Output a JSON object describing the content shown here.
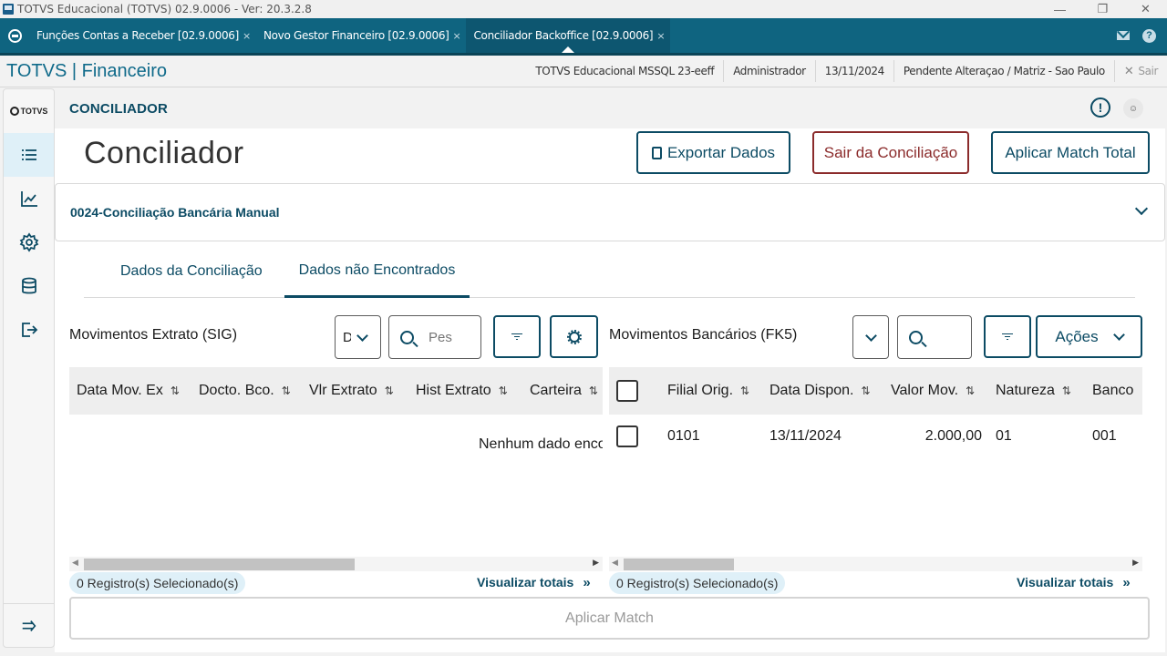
{
  "window": {
    "title": "TOTVS Educacional (TOTVS) 02.9.0006 - Ver: 20.3.2.8"
  },
  "tabs": [
    {
      "label": "Funções Contas a Receber [02.9.0006]",
      "close": "×"
    },
    {
      "label": "Novo Gestor Financeiro [02.9.0006]",
      "close": "×"
    },
    {
      "label": "Conciliador Backoffice [02.9.0006]",
      "close": "×"
    }
  ],
  "header": {
    "brand": "TOTVS | Financeiro",
    "environment": "TOTVS Educacional MSSQL 23-eeff",
    "user": "Administrador",
    "date": "13/11/2024",
    "branch": "Pendente Alteraçao / Matriz - Sao Paulo",
    "exit": "Sair"
  },
  "sidebar": {
    "logo": "TOTVS"
  },
  "breadcrumb": "CONCILIADOR",
  "page": {
    "title": "Conciliador",
    "export_label": "Exportar Dados",
    "exit_conciliation_label": "Sair da Conciliação",
    "apply_total_label": "Aplicar Match Total",
    "config_name": "0024-Conciliação Bancária Manual",
    "tabs": [
      "Dados da Conciliação",
      "Dados não Encontrados"
    ],
    "apply_match_label": "Aplicar Match"
  },
  "left_panel": {
    "title": "Movimentos Extrato (SIG)",
    "field_select_value": "D",
    "search_placeholder": "Pes",
    "columns": [
      "Data Mov. Ex",
      "Docto. Bco.",
      "Vlr Extrato",
      "Hist Extrato",
      "Carteira"
    ],
    "empty_message": "Nenhum dado encontrado",
    "selected_count": "0 Registro(s) Selecionado(s)",
    "totals_link": "Visualizar totais",
    "totals_arrow": "»"
  },
  "right_panel": {
    "title": "Movimentos Bancários (FK5)",
    "actions_label": "Ações",
    "columns": [
      "Filial Orig.",
      "Data Dispon.",
      "Valor Mov.",
      "Natureza",
      "Banco"
    ],
    "rows": [
      {
        "filial": "0101",
        "data": "13/11/2024",
        "valor": "2.000,00",
        "natureza": "01",
        "banco": "001"
      }
    ],
    "selected_count": "0 Registro(s) Selecionado(s)",
    "totals_link": "Visualizar totais",
    "totals_arrow": "»"
  }
}
